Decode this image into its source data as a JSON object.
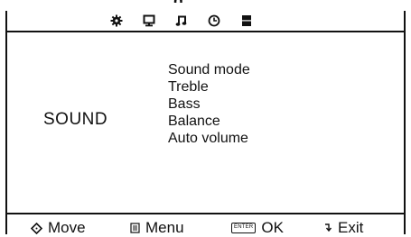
{
  "header": {
    "partial_title": "g"
  },
  "tabs": [
    {
      "icon": "gear-icon"
    },
    {
      "icon": "monitor-icon"
    },
    {
      "icon": "music-note-icon"
    },
    {
      "icon": "clock-icon"
    },
    {
      "icon": "block-icon"
    }
  ],
  "section_title": "SOUND",
  "menu_items": [
    "Sound mode",
    "Treble",
    "Bass",
    "Balance",
    "Auto volume"
  ],
  "footer": {
    "move_label": "Move",
    "menu_label": "Menu",
    "enter_key": "ENTER",
    "ok_label": "OK",
    "exit_label": "Exit"
  }
}
